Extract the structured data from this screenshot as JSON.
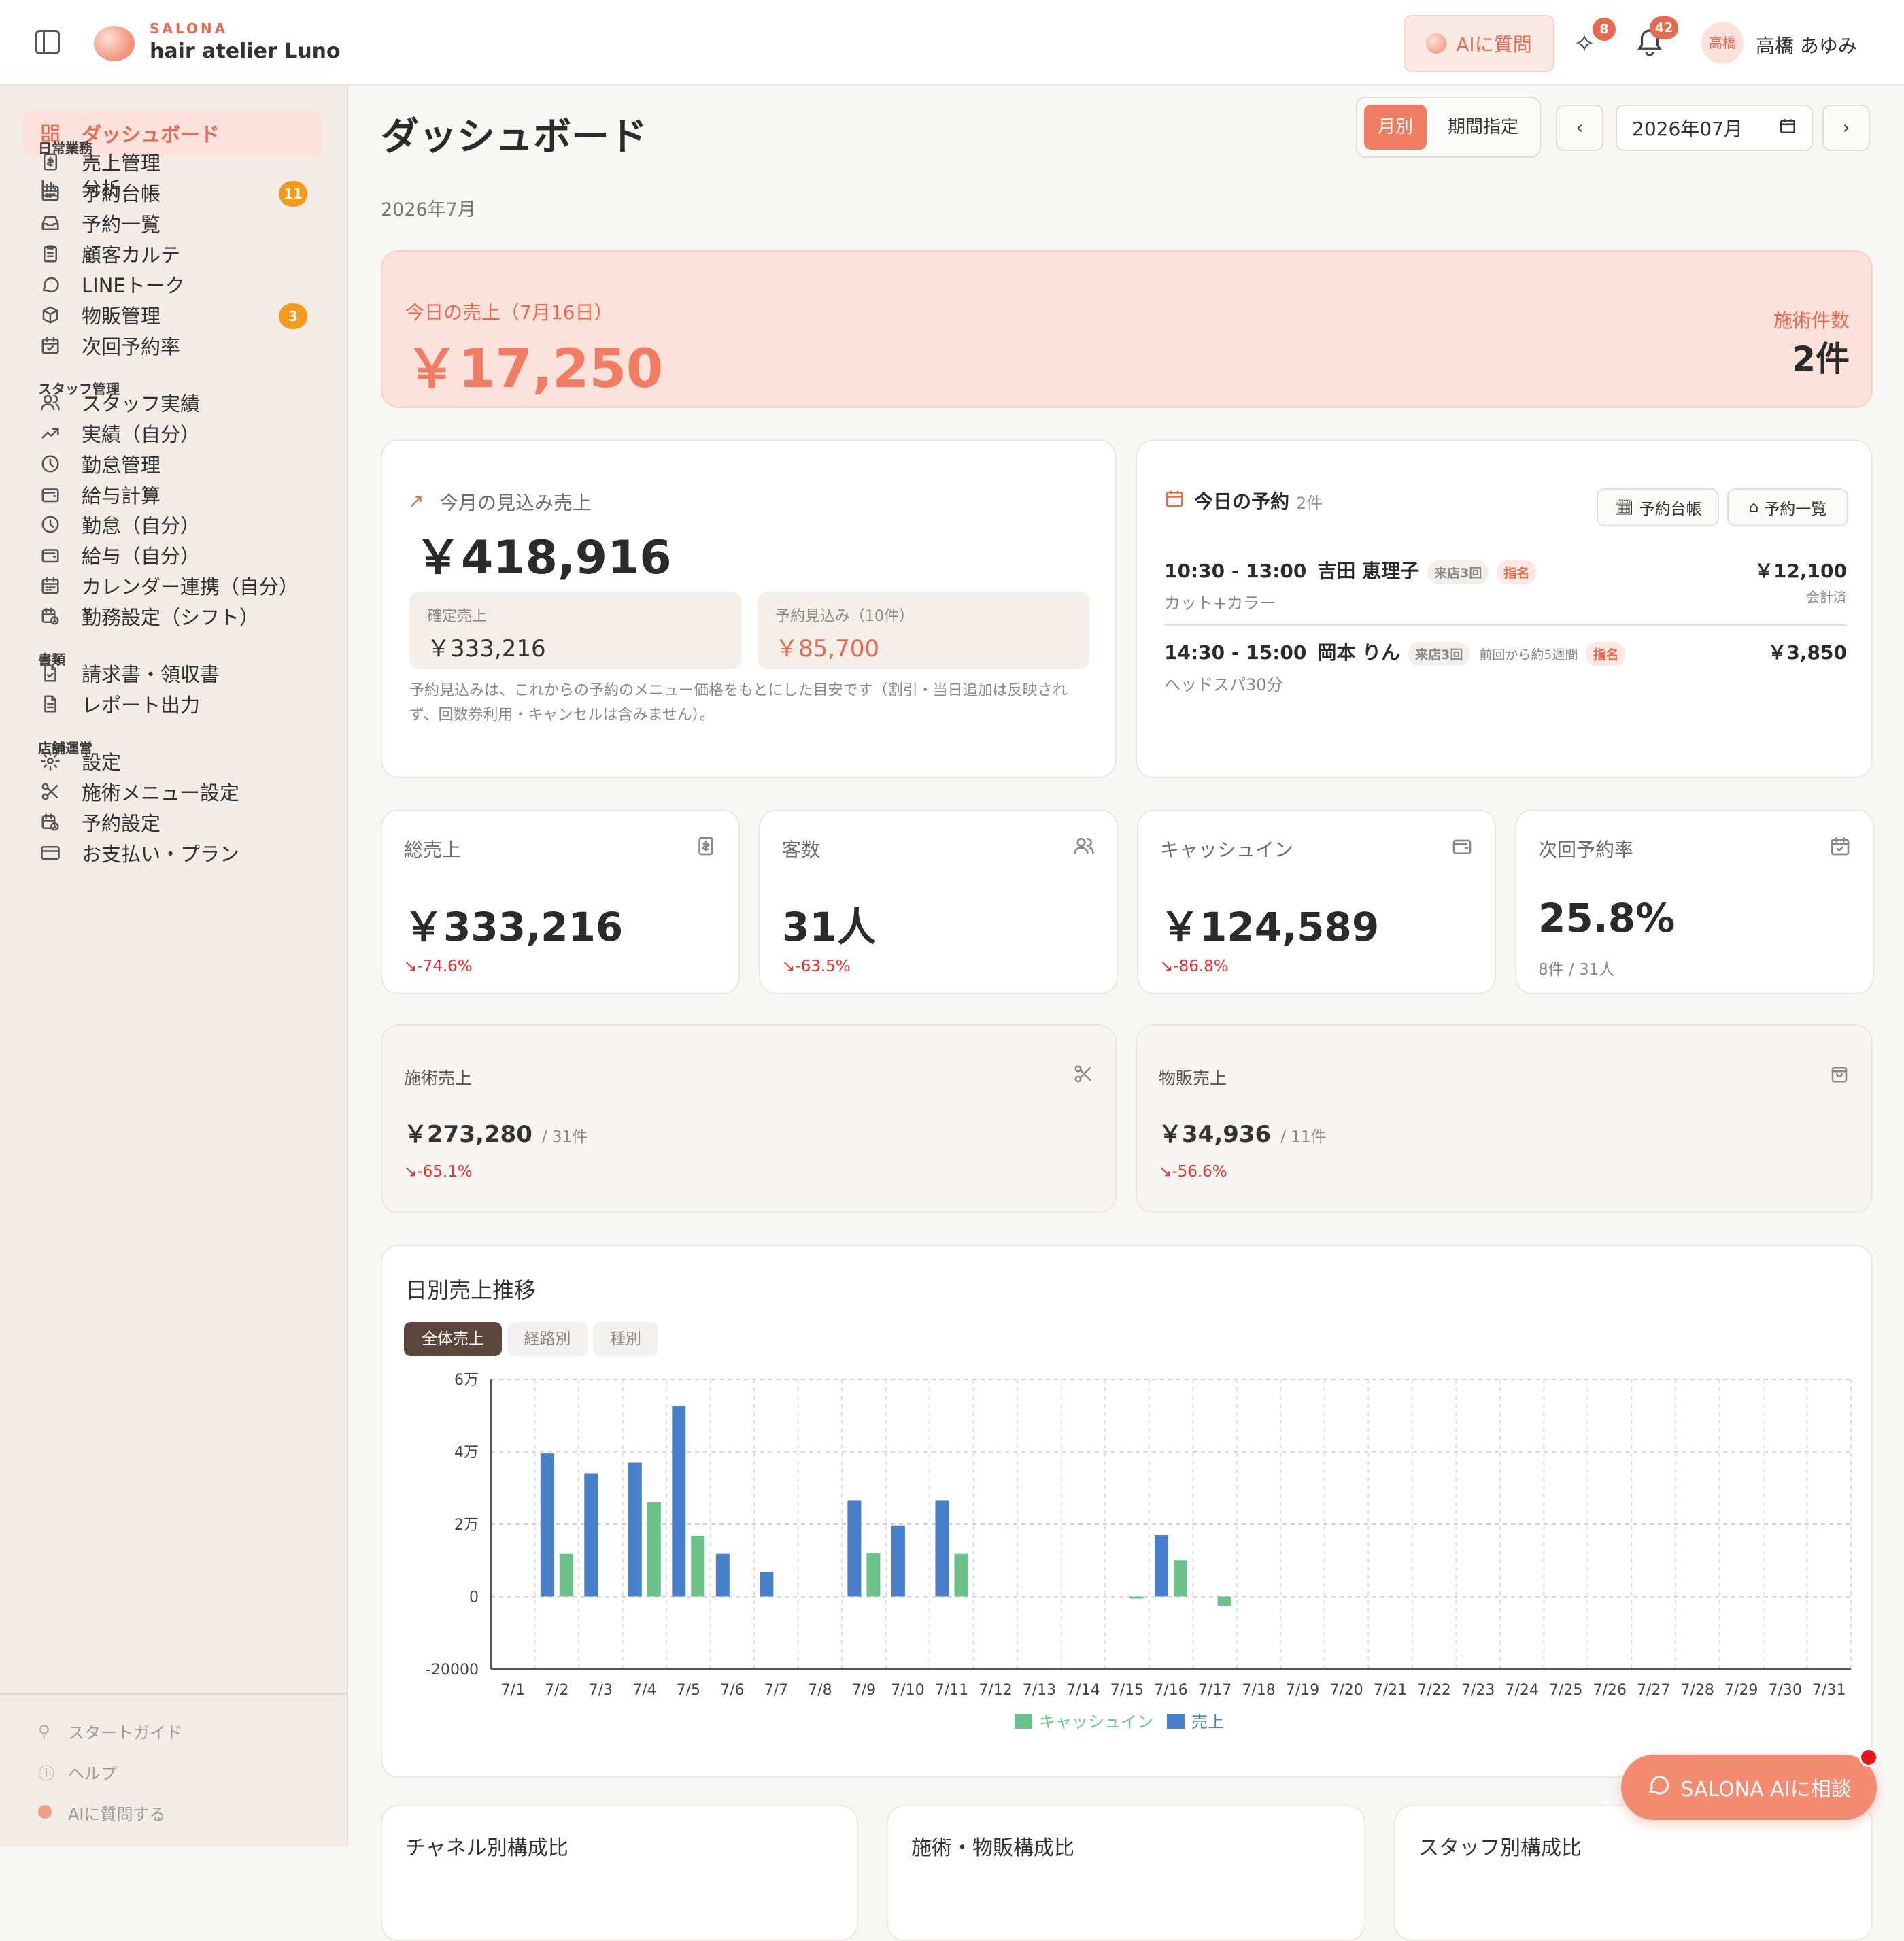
{
  "header": {
    "brand_small": "SALONA",
    "brand": "hair atelier Luno",
    "ai_button": "AIに質問",
    "sparkle_count": "8",
    "bell_count": "42",
    "avatar_initials": "高橋",
    "user_name": "高橋 あゆみ"
  },
  "sidebar": {
    "items": [
      {
        "label": "ダッシュボード",
        "icon": "dashboard-icon"
      },
      {
        "label": "分析",
        "icon": "bar-chart-icon"
      }
    ],
    "sections": [
      {
        "title": "日常業務",
        "items": [
          {
            "label": "売上管理",
            "icon": "receipt-icon"
          },
          {
            "label": "予約台帳",
            "icon": "calendar-icon",
            "badge": "11"
          },
          {
            "label": "予約一覧",
            "icon": "inbox-icon"
          },
          {
            "label": "顧客カルテ",
            "icon": "clipboard-icon"
          },
          {
            "label": "LINEトーク",
            "icon": "chat-icon"
          },
          {
            "label": "物販管理",
            "icon": "box-icon",
            "badge": "3"
          },
          {
            "label": "次回予約率",
            "icon": "calendar-check-icon"
          }
        ]
      },
      {
        "title": "スタッフ管理",
        "items": [
          {
            "label": "スタッフ実績",
            "icon": "users-icon"
          },
          {
            "label": "実績（自分）",
            "icon": "trend-icon"
          },
          {
            "label": "勤怠管理",
            "icon": "clock-icon"
          },
          {
            "label": "給与計算",
            "icon": "wallet-icon"
          },
          {
            "label": "勤怠（自分）",
            "icon": "clock-icon"
          },
          {
            "label": "給与（自分）",
            "icon": "wallet-icon"
          },
          {
            "label": "カレンダー連携（自分）",
            "icon": "calendar-icon"
          },
          {
            "label": "勤務設定（シフト）",
            "icon": "calendar-clock-icon"
          }
        ]
      },
      {
        "title": "書類",
        "items": [
          {
            "label": "請求書・領収書",
            "icon": "file-check-icon"
          },
          {
            "label": "レポート出力",
            "icon": "file-text-icon"
          }
        ]
      },
      {
        "title": "店舗運営",
        "items": [
          {
            "label": "設定",
            "icon": "gear-icon"
          },
          {
            "label": "施術メニュー設定",
            "icon": "scissors-icon"
          },
          {
            "label": "予約設定",
            "icon": "calendar-clock-icon"
          },
          {
            "label": "お支払い・プラン",
            "icon": "credit-card-icon"
          }
        ]
      }
    ],
    "footer": [
      "スタートガイド",
      "ヘルプ",
      "AIに質問する"
    ]
  },
  "page": {
    "title": "ダッシュボード",
    "period": "2026年7月",
    "toggle_monthly": "月別",
    "toggle_range": "期間指定",
    "month_value": "2026年07月",
    "prev": "‹",
    "next": "›"
  },
  "today": {
    "label": "今日の売上（7月16日）",
    "amount": "￥17,250",
    "count_label": "施術件数",
    "count": "2件"
  },
  "forecast": {
    "label": "今月の見込み売上",
    "amount": "￥418,916",
    "confirmed_label": "確定売上",
    "confirmed": "￥333,216",
    "expected_label": "予約見込み（10件）",
    "expected": "￥85,700",
    "note": "予約見込みは、これからの予約のメニュー価格をもとにした目安です（割引・当日追加は反映されず、回数券利用・キャンセルは含みません）。"
  },
  "reservations": {
    "title": "今日の予約",
    "count": "2件",
    "btn_ledger": "予約台帳",
    "btn_list": "予約一覧",
    "items": [
      {
        "time": "10:30 - 13:00",
        "name": "吉田 恵理子",
        "visits": "来店3回",
        "extra": "",
        "nominated": "指名",
        "menu": "カット+カラー",
        "price": "￥12,100",
        "status": "会計済"
      },
      {
        "time": "14:30 - 15:00",
        "name": "岡本 りん",
        "visits": "来店3回",
        "extra": "前回から約5週間",
        "nominated": "指名",
        "menu": "ヘッドスパ30分",
        "price": "￥3,850",
        "status": ""
      }
    ]
  },
  "kpis": [
    {
      "label": "総売上",
      "value": "￥333,216",
      "change": "-74.6%",
      "icon": "receipt-icon"
    },
    {
      "label": "客数",
      "value": "31人",
      "change": "-63.5%",
      "icon": "users-icon"
    },
    {
      "label": "キャッシュイン",
      "value": "￥124,589",
      "change": "-86.8%",
      "icon": "wallet-icon"
    },
    {
      "label": "次回予約率",
      "value": "25.8%",
      "sub": "8件 / 31人",
      "icon": "calendar-check-icon"
    }
  ],
  "subkpis": [
    {
      "label": "施術売上",
      "value": "￥273,280",
      "count": "/ 31件",
      "change": "-65.1%",
      "icon": "scissors-icon"
    },
    {
      "label": "物販売上",
      "value": "￥34,936",
      "count": "/ 11件",
      "change": "-56.6%",
      "icon": "bag-icon"
    }
  ],
  "chart_tabs": [
    "全体売上",
    "経路別",
    "種別"
  ],
  "chart_data": {
    "type": "bar",
    "title": "日別売上推移",
    "categories": [
      "7/1",
      "7/2",
      "7/3",
      "7/4",
      "7/5",
      "7/6",
      "7/7",
      "7/8",
      "7/9",
      "7/10",
      "7/11",
      "7/12",
      "7/13",
      "7/14",
      "7/15",
      "7/16",
      "7/17",
      "7/18",
      "7/19",
      "7/20",
      "7/21",
      "7/22",
      "7/23",
      "7/24",
      "7/25",
      "7/26",
      "7/27",
      "7/28",
      "7/29",
      "7/30",
      "7/31"
    ],
    "y_ticks": [
      "6万",
      "4万",
      "2万",
      "0",
      "-20000"
    ],
    "ylim": [
      -20000,
      60000
    ],
    "series": [
      {
        "name": "売上",
        "color": "#4a7fcb",
        "values": [
          0,
          39500,
          34000,
          37000,
          52500,
          11800,
          6800,
          0,
          26500,
          19500,
          26500,
          0,
          0,
          0,
          0,
          17000,
          0,
          0,
          0,
          0,
          0,
          0,
          0,
          0,
          0,
          0,
          0,
          0,
          0,
          0,
          0
        ]
      },
      {
        "name": "キャッシュイン",
        "color": "#6cc28a",
        "values": [
          0,
          11800,
          0,
          26000,
          16800,
          0,
          0,
          0,
          12000,
          0,
          11800,
          0,
          0,
          0,
          -500,
          10000,
          -2600,
          0,
          0,
          0,
          0,
          0,
          0,
          0,
          0,
          0,
          0,
          0,
          0,
          0,
          0
        ]
      }
    ],
    "grid": true,
    "legend": "bottom"
  },
  "bottom_cards": [
    "チャネル別構成比",
    "施術・物販構成比",
    "スタッフ別構成比"
  ],
  "fab": "SALONA AIに相談"
}
